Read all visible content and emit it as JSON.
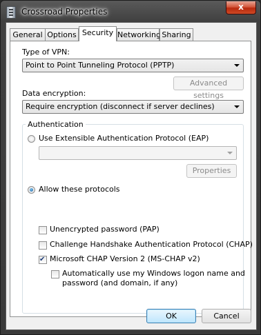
{
  "window": {
    "title": "Crossroad Properties",
    "close_glyph": "x"
  },
  "tabs": [
    {
      "label": "General"
    },
    {
      "label": "Options"
    },
    {
      "label": "Security"
    },
    {
      "label": "Networking"
    },
    {
      "label": "Sharing"
    }
  ],
  "security": {
    "vpn_type_label": "Type of VPN:",
    "vpn_type_value": "Point to Point Tunneling Protocol (PPTP)",
    "advanced_settings": "Advanced settings",
    "encryption_label": "Data encryption:",
    "encryption_value": "Require encryption (disconnect if server declines)",
    "auth_group": "Authentication",
    "eap_radio": "Use Extensible Authentication Protocol (EAP)",
    "eap_value": "",
    "properties": "Properties",
    "allow_radio": "Allow these protocols",
    "protocols": {
      "pap": "Unencrypted password (PAP)",
      "chap": "Challenge Handshake Authentication Protocol (CHAP)",
      "mschapv2": "Microsoft CHAP Version 2 (MS-CHAP v2)",
      "auto_logon_1": "Automatically use my Windows logon name and",
      "auto_logon_2": "password (and domain, if any)"
    }
  },
  "buttons": {
    "ok": "OK",
    "cancel": "Cancel"
  }
}
